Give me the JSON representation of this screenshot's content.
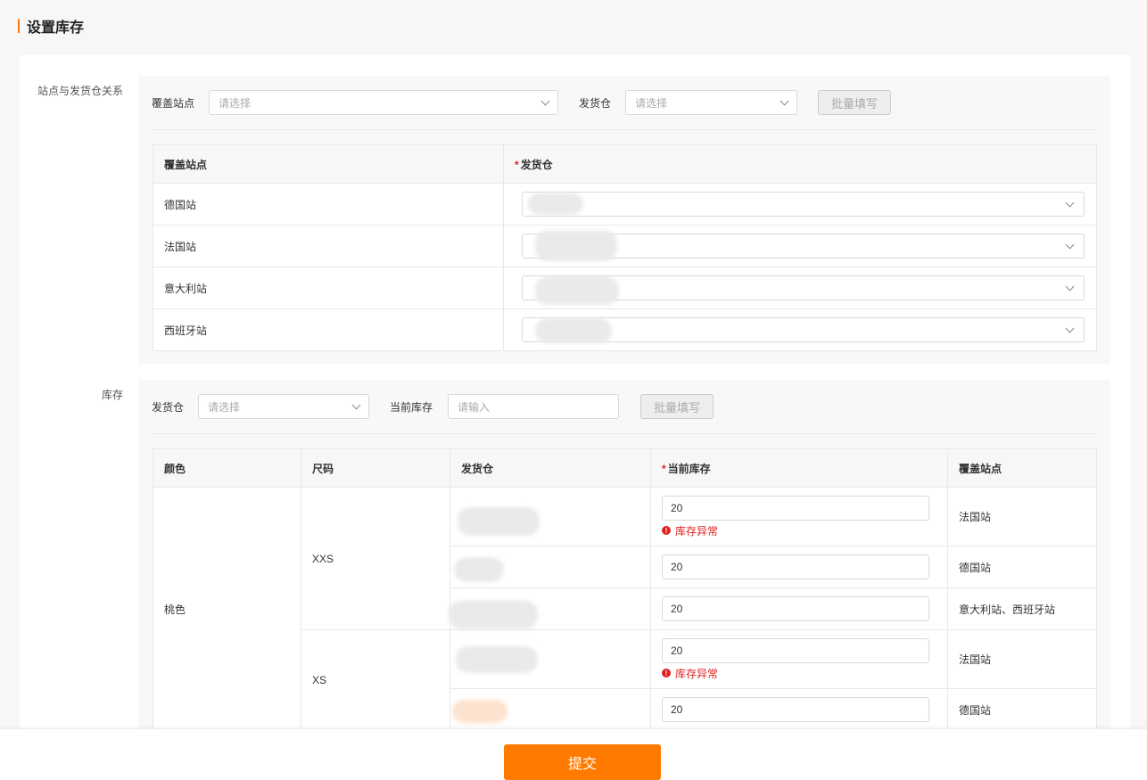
{
  "page": {
    "title": "设置库存"
  },
  "section1": {
    "label": "站点与发货仓关系",
    "cover_site_label": "覆盖站点",
    "cover_site_placeholder": "请选择",
    "warehouse_label": "发货仓",
    "warehouse_placeholder": "请选择",
    "batch_button": "批量填写",
    "table": {
      "headers": [
        "覆盖站点",
        "发货仓"
      ],
      "required_mark": "*",
      "rows": [
        {
          "site": "德国站"
        },
        {
          "site": "法国站"
        },
        {
          "site": "意大利站"
        },
        {
          "site": "西班牙站"
        }
      ]
    }
  },
  "section2": {
    "label": "库存",
    "warehouse_label": "发货仓",
    "warehouse_placeholder": "请选择",
    "stock_label": "当前库存",
    "stock_placeholder": "请输入",
    "batch_button": "批量填写",
    "table": {
      "headers": [
        "颜色",
        "尺码",
        "发货仓",
        "当前库存",
        "覆盖站点"
      ],
      "required_mark": "*",
      "color": "桃色",
      "sizes": [
        "XXS",
        "XS"
      ],
      "error_text": "库存异常",
      "rows": [
        {
          "stock": "20",
          "site": "法国站",
          "error": true
        },
        {
          "stock": "20",
          "site": "德国站",
          "error": false
        },
        {
          "stock": "20",
          "site": "意大利站、西班牙站",
          "error": false
        },
        {
          "stock": "20",
          "site": "法国站",
          "error": true
        },
        {
          "stock": "20",
          "site": "德国站",
          "error": false
        }
      ]
    }
  },
  "footer": {
    "submit_label": "提交"
  },
  "colors": {
    "accent": "#ff7a00",
    "error": "#e02020"
  }
}
